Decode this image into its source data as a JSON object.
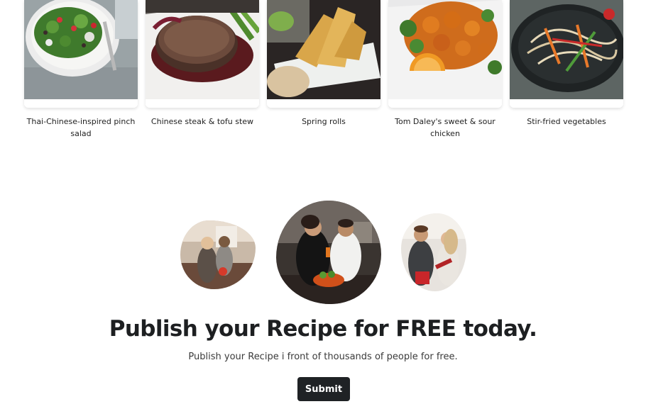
{
  "recipes": [
    {
      "title": "Thai-Chinese-inspired pinch salad",
      "image": "salad-photo"
    },
    {
      "title": "Chinese steak & tofu stew",
      "image": "steak-photo"
    },
    {
      "title": "Spring rolls",
      "image": "spring-rolls-photo"
    },
    {
      "title": "Tom Daley's sweet & sour chicken",
      "image": "sweet-sour-chicken-photo"
    },
    {
      "title": "Stir-fried vegetables",
      "image": "stir-fried-vegetables-photo"
    }
  ],
  "publish": {
    "images": [
      "couple-cooking-photo",
      "friends-in-kitchen-photo",
      "couple-reading-recipe-photo"
    ],
    "title": "Publish your Recipe for FREE today.",
    "subtitle": "Publish your Recipe i front of thousands of people for free.",
    "submit_label": "Submit"
  },
  "colors": {
    "button_bg": "#1f2225",
    "button_text": "#ffffff",
    "heading": "#1d1f21"
  }
}
